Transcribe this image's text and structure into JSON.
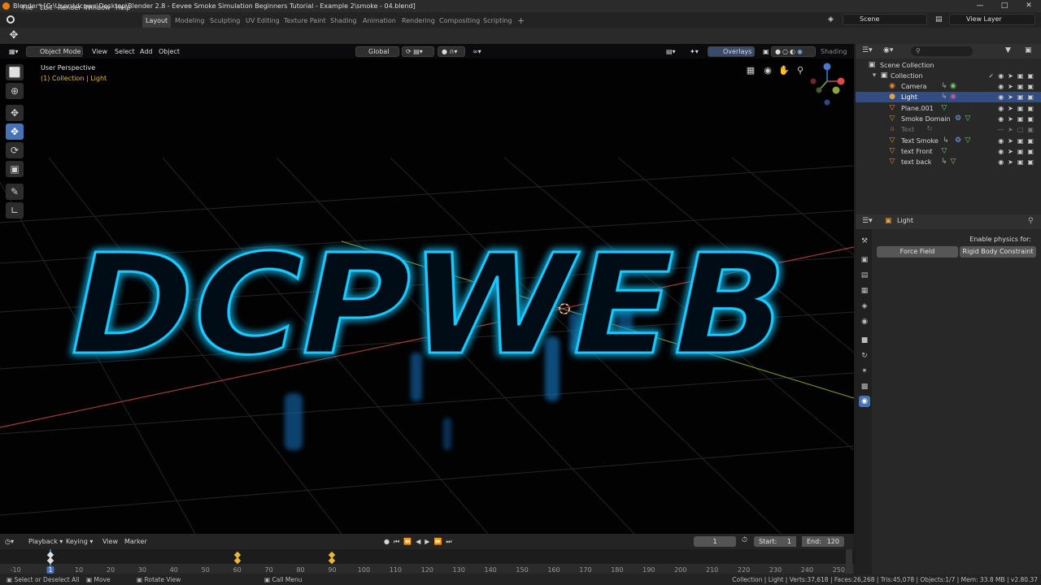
{
  "window": {
    "title": "Blender* [C:\\Users\\dcpwe\\Desktop\\Blender 2.8 - Eevee Smoke Simulation Beginners Tutorial - Example 2\\smoke - 04.blend]"
  },
  "menu": {
    "items": [
      "File",
      "Edit",
      "Render",
      "Window",
      "Help"
    ]
  },
  "workspaces": {
    "tabs": [
      "Layout",
      "Modeling",
      "Sculpting",
      "UV Editing",
      "Texture Paint",
      "Shading",
      "Animation",
      "Rendering",
      "Compositing",
      "Scripting"
    ],
    "active": "Layout"
  },
  "scene": {
    "name": "Scene",
    "view_layer": "View Layer"
  },
  "viewport_header": {
    "mode": "Object Mode",
    "view": "View",
    "select": "Select",
    "add": "Add",
    "object": "Object",
    "orientation": "Global",
    "overlays": "Overlays",
    "shading": "Shading"
  },
  "viewport": {
    "perspective": "User Perspective",
    "context": "(1) Collection | Light",
    "scene_text": "DCPWEB"
  },
  "outliner": {
    "root": "Scene Collection",
    "collection": "Collection",
    "items": [
      {
        "name": "Camera",
        "icon": "camera-icon",
        "selected": false,
        "hidden": false
      },
      {
        "name": "Light",
        "icon": "light-icon",
        "selected": true,
        "hidden": false
      },
      {
        "name": "Plane.001",
        "icon": "mesh-icon",
        "selected": false,
        "hidden": false
      },
      {
        "name": "Smoke Domain",
        "icon": "mesh-icon",
        "selected": false,
        "hidden": false
      },
      {
        "name": "Text",
        "icon": "text-icon",
        "selected": false,
        "hidden": true
      },
      {
        "name": "Text Smoke",
        "icon": "mesh-icon",
        "selected": false,
        "hidden": false
      },
      {
        "name": "text Front",
        "icon": "mesh-icon",
        "selected": false,
        "hidden": false
      },
      {
        "name": "text back",
        "icon": "mesh-icon",
        "selected": false,
        "hidden": false
      }
    ]
  },
  "properties": {
    "object": "Light",
    "physics_label": "Enable physics for:",
    "force_field": "Force Field",
    "rigid_body": "Rigid Body Constraint"
  },
  "timeline": {
    "playback": "Playback",
    "keying": "Keying",
    "view": "View",
    "marker": "Marker",
    "current_frame": "1",
    "start_label": "Start:",
    "start": "1",
    "end_label": "End:",
    "end": "120",
    "ticks": [
      "-10",
      "1",
      "10",
      "20",
      "30",
      "40",
      "50",
      "60",
      "70",
      "80",
      "90",
      "100",
      "110",
      "120",
      "130",
      "140",
      "150",
      "160",
      "170",
      "180",
      "190",
      "200",
      "210",
      "220",
      "230",
      "240",
      "250"
    ],
    "keyframes": [
      1,
      60,
      90
    ]
  },
  "status": {
    "select": "Select or Deselect All",
    "move": "Move",
    "rotate": "Rotate View",
    "call_menu": "Call Menu",
    "stats": "Collection | Light | Verts:37,618 | Faces:26,268 | Tris:45,078 | Objects:1/7 | Mem: 33.8 MB | v2.80.37"
  },
  "colors": {
    "accent": "#4772b3",
    "glow": "#1ec8ff",
    "key": "#e8b640",
    "x_axis": "#c84a4a",
    "y_axis": "#8aa63a"
  }
}
